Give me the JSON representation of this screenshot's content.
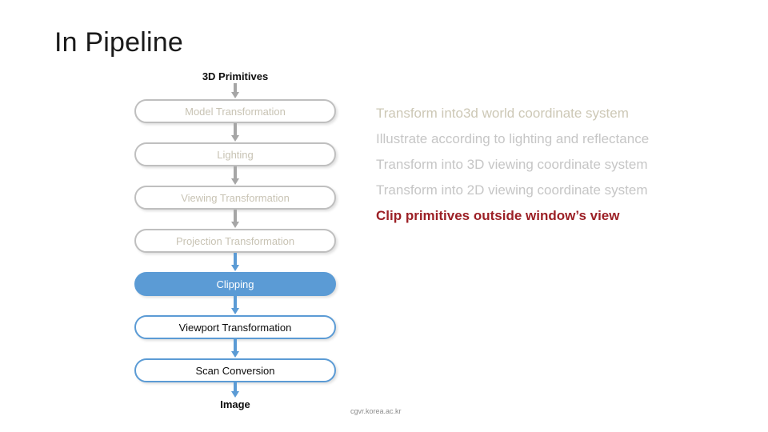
{
  "slide": {
    "title": "In Pipeline",
    "footer_url": "cgvr.korea.ac.kr"
  },
  "colors": {
    "active_fill": "#5B9BD5",
    "active_text": "#FFFFFF",
    "dim_border": "#BFBFBF",
    "dim_text": "#C8C3B4",
    "live_border": "#5B9BD5",
    "accent_text": "#9C2026",
    "arrow_gray": "#A6A6A6",
    "arrow_blue": "#5B9BD5"
  },
  "flow": {
    "input_label": "3D Primitives",
    "output_label": "Image",
    "stages": [
      {
        "label": "Model Transformation",
        "state": "dim"
      },
      {
        "label": "Lighting",
        "state": "dim"
      },
      {
        "label": "Viewing Transformation",
        "state": "dim"
      },
      {
        "label": "Projection Transformation",
        "state": "dim"
      },
      {
        "label": "Clipping",
        "state": "active"
      },
      {
        "label": "Viewport Transformation",
        "state": "live"
      },
      {
        "label": "Scan Conversion",
        "state": "live"
      }
    ]
  },
  "descriptions": [
    {
      "text": "Transform into3d world coordinate system",
      "style": "dim-warm"
    },
    {
      "text": "Illustrate according to lighting and reflectance",
      "style": "dim-gray"
    },
    {
      "text": "Transform into 3D viewing coordinate system",
      "style": "dim-gray"
    },
    {
      "text": "Transform into 2D viewing coordinate system",
      "style": "dim-gray"
    },
    {
      "text": "Clip primitives outside window’s view",
      "style": "accent"
    }
  ]
}
